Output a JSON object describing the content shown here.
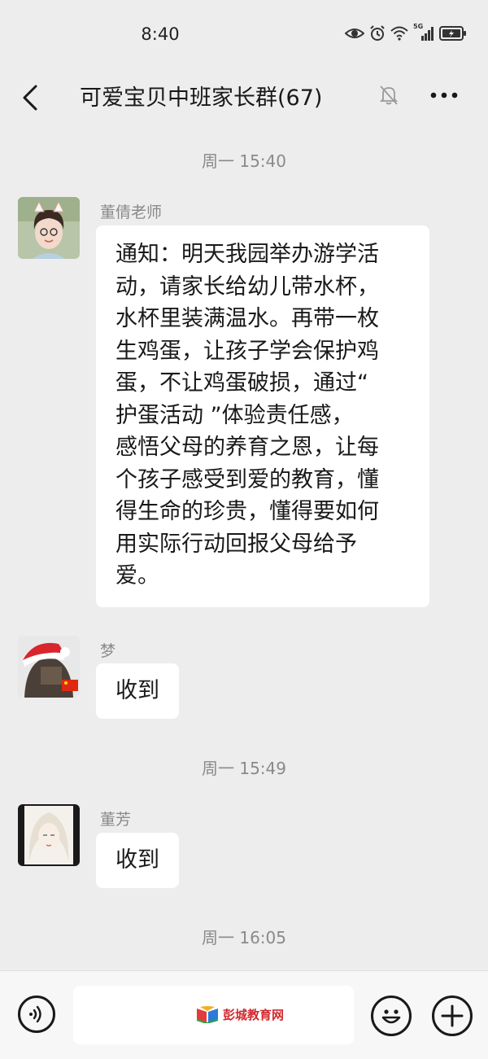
{
  "status_bar": {
    "time": "8:40",
    "icons": [
      "eye-icon",
      "alarm-icon",
      "wifi-icon",
      "signal-5g-icon",
      "battery-icon"
    ],
    "network_label": "5G"
  },
  "nav": {
    "title": "可爱宝贝中班家长群(67)",
    "back_icon": "chevron-left-icon",
    "mute_icon": "bell-off-icon",
    "more_icon": "more-icon"
  },
  "messages": {
    "time1": "周一 15:40",
    "m1": {
      "sender": "董倩老师",
      "lines": [
        "通知：明天我园举办游学活",
        "动，请家长给幼儿带水杯，",
        "水杯里装满温水。再带一枚",
        "生鸡蛋，让孩子学会保护鸡",
        "蛋，不让鸡蛋破损，通过“",
        "护蛋活动 ”体验责任感，",
        "感悟父母的养育之恩，让每",
        "个孩子感受到爱的教育，懂",
        "得生命的珍贵，懂得要如何",
        "用实际行动回报父母给予",
        "爱。"
      ]
    },
    "m2": {
      "sender": "梦",
      "text": "收到"
    },
    "time2": "周一 15:49",
    "m3": {
      "sender": "董芳",
      "text": "收到"
    },
    "time3": "周一 16:05"
  },
  "input_bar": {
    "voice_icon": "voice-icon",
    "emoji_icon": "emoji-icon",
    "plus_icon": "plus-icon",
    "watermark": "彭城教育网"
  },
  "colors": {
    "background": "#ededed",
    "bubble": "#ffffff",
    "meta_text": "#8a8a8a",
    "watermark": "#d2282e"
  }
}
